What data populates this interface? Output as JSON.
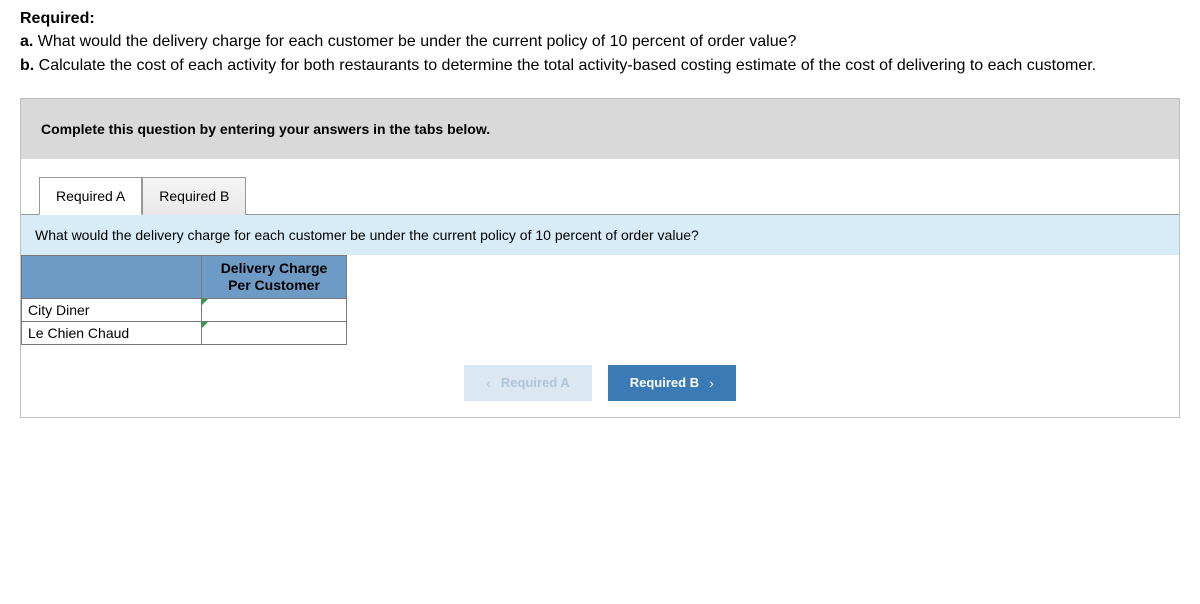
{
  "required": {
    "title": "Required:",
    "items": [
      {
        "letter": "a.",
        "text": " What would the delivery charge for each customer be under the current policy of 10 percent of order value?"
      },
      {
        "letter": "b.",
        "text": " Calculate the cost of each activity for both restaurants to determine the total activity-based costing estimate of the cost of delivering to each customer."
      }
    ]
  },
  "instruction": "Complete this question by entering your answers in the tabs below.",
  "tabs": [
    {
      "label": "Required A",
      "active": true
    },
    {
      "label": "Required B",
      "active": false
    }
  ],
  "question": "What would the delivery charge for each customer be under the current policy of 10 percent of order value?",
  "table": {
    "column_header": "Delivery Charge Per Customer",
    "rows": [
      {
        "label": "City Diner",
        "value": ""
      },
      {
        "label": "Le Chien Chaud",
        "value": ""
      }
    ]
  },
  "nav": {
    "prev": {
      "label": "Required A",
      "chevron": "‹"
    },
    "next": {
      "label": "Required B",
      "chevron": "›"
    }
  }
}
